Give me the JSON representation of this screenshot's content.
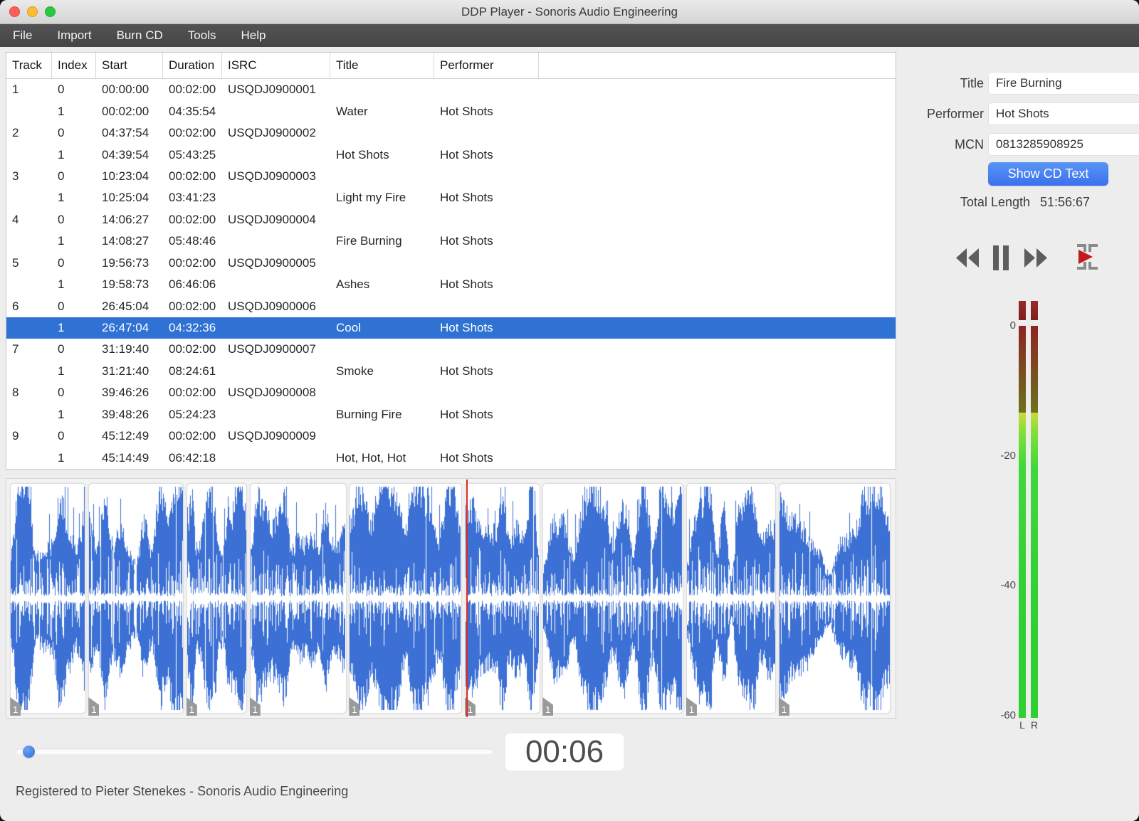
{
  "window": {
    "title": "DDP Player - Sonoris Audio Engineering"
  },
  "menu": {
    "items": [
      "File",
      "Import",
      "Burn CD",
      "Tools",
      "Help"
    ]
  },
  "table": {
    "columns": [
      "Track",
      "Index",
      "Start",
      "Duration",
      "ISRC",
      "Title",
      "Performer"
    ],
    "rows": [
      {
        "track": "1",
        "index": "0",
        "start": "00:00:00",
        "duration": "00:02:00",
        "isrc": "USQDJ0900001",
        "title": "",
        "performer": "",
        "selected": false
      },
      {
        "track": "",
        "index": "1",
        "start": "00:02:00",
        "duration": "04:35:54",
        "isrc": "",
        "title": "Water",
        "performer": "Hot Shots",
        "selected": false
      },
      {
        "track": "2",
        "index": "0",
        "start": "04:37:54",
        "duration": "00:02:00",
        "isrc": "USQDJ0900002",
        "title": "",
        "performer": "",
        "selected": false
      },
      {
        "track": "",
        "index": "1",
        "start": "04:39:54",
        "duration": "05:43:25",
        "isrc": "",
        "title": "Hot Shots",
        "performer": "Hot Shots",
        "selected": false
      },
      {
        "track": "3",
        "index": "0",
        "start": "10:23:04",
        "duration": "00:02:00",
        "isrc": "USQDJ0900003",
        "title": "",
        "performer": "",
        "selected": false
      },
      {
        "track": "",
        "index": "1",
        "start": "10:25:04",
        "duration": "03:41:23",
        "isrc": "",
        "title": "Light my Fire",
        "performer": "Hot Shots",
        "selected": false
      },
      {
        "track": "4",
        "index": "0",
        "start": "14:06:27",
        "duration": "00:02:00",
        "isrc": "USQDJ0900004",
        "title": "",
        "performer": "",
        "selected": false
      },
      {
        "track": "",
        "index": "1",
        "start": "14:08:27",
        "duration": "05:48:46",
        "isrc": "",
        "title": "Fire Burning",
        "performer": "Hot Shots",
        "selected": false
      },
      {
        "track": "5",
        "index": "0",
        "start": "19:56:73",
        "duration": "00:02:00",
        "isrc": "USQDJ0900005",
        "title": "",
        "performer": "",
        "selected": false
      },
      {
        "track": "",
        "index": "1",
        "start": "19:58:73",
        "duration": "06:46:06",
        "isrc": "",
        "title": "Ashes",
        "performer": "Hot Shots",
        "selected": false
      },
      {
        "track": "6",
        "index": "0",
        "start": "26:45:04",
        "duration": "00:02:00",
        "isrc": "USQDJ0900006",
        "title": "",
        "performer": "",
        "selected": false
      },
      {
        "track": "",
        "index": "1",
        "start": "26:47:04",
        "duration": "04:32:36",
        "isrc": "",
        "title": "Cool",
        "performer": "Hot Shots",
        "selected": true
      },
      {
        "track": "7",
        "index": "0",
        "start": "31:19:40",
        "duration": "00:02:00",
        "isrc": "USQDJ0900007",
        "title": "",
        "performer": "",
        "selected": false
      },
      {
        "track": "",
        "index": "1",
        "start": "31:21:40",
        "duration": "08:24:61",
        "isrc": "",
        "title": "Smoke",
        "performer": "Hot Shots",
        "selected": false
      },
      {
        "track": "8",
        "index": "0",
        "start": "39:46:26",
        "duration": "00:02:00",
        "isrc": "USQDJ0900008",
        "title": "",
        "performer": "",
        "selected": false
      },
      {
        "track": "",
        "index": "1",
        "start": "39:48:26",
        "duration": "05:24:23",
        "isrc": "",
        "title": "Burning Fire",
        "performer": "Hot Shots",
        "selected": false
      },
      {
        "track": "9",
        "index": "0",
        "start": "45:12:49",
        "duration": "00:02:00",
        "isrc": "USQDJ0900009",
        "title": "",
        "performer": "",
        "selected": false
      },
      {
        "track": "",
        "index": "1",
        "start": "45:14:49",
        "duration": "06:42:18",
        "isrc": "",
        "title": "Hot, Hot, Hot",
        "performer": "Hot Shots",
        "selected": false
      }
    ]
  },
  "side": {
    "fields": [
      {
        "label": "Title",
        "value": "Fire Burning"
      },
      {
        "label": "Performer",
        "value": "Hot Shots"
      },
      {
        "label": "MCN",
        "value": "0813285908925"
      }
    ],
    "button_label": "Show CD Text",
    "total_length_label": "Total Length",
    "total_length_value": "51:56:67"
  },
  "transport": {
    "icons": [
      "rewind-icon",
      "pause-icon",
      "fast-forward-icon",
      "play-marker-icon"
    ]
  },
  "meter": {
    "scale_labels": [
      "0",
      "-20",
      "-40",
      "-60"
    ],
    "channel_labels": [
      "L",
      "R"
    ],
    "dim_fraction": 0.221
  },
  "waveform": {
    "playhead_fraction": 0.5175,
    "segments": [
      {
        "start": 0.001,
        "end": 0.0885,
        "flag": "1"
      },
      {
        "start": 0.0897,
        "end": 0.1993,
        "flag": "1"
      },
      {
        "start": 0.2005,
        "end": 0.2709,
        "flag": "1"
      },
      {
        "start": 0.2722,
        "end": 0.3834,
        "flag": "1"
      },
      {
        "start": 0.3847,
        "end": 0.5144,
        "flag": "1"
      },
      {
        "start": 0.5156,
        "end": 0.6024,
        "flag": "1"
      },
      {
        "start": 0.6037,
        "end": 0.765,
        "flag": "1"
      },
      {
        "start": 0.7663,
        "end": 0.8698,
        "flag": "1"
      },
      {
        "start": 0.871,
        "end": 0.9995,
        "flag": "1"
      }
    ]
  },
  "player": {
    "time": "00:06",
    "slider_fraction": 0.028
  },
  "statusbar": {
    "text": "Registered to Pieter Stenekes - Sonoris Audio Engineering"
  },
  "colors": {
    "selection": "#2f72d4",
    "waveform": "#3c70d4",
    "playhead": "#dd2b20",
    "button_top": "#5996f4",
    "button_bottom": "#3b70ee"
  }
}
